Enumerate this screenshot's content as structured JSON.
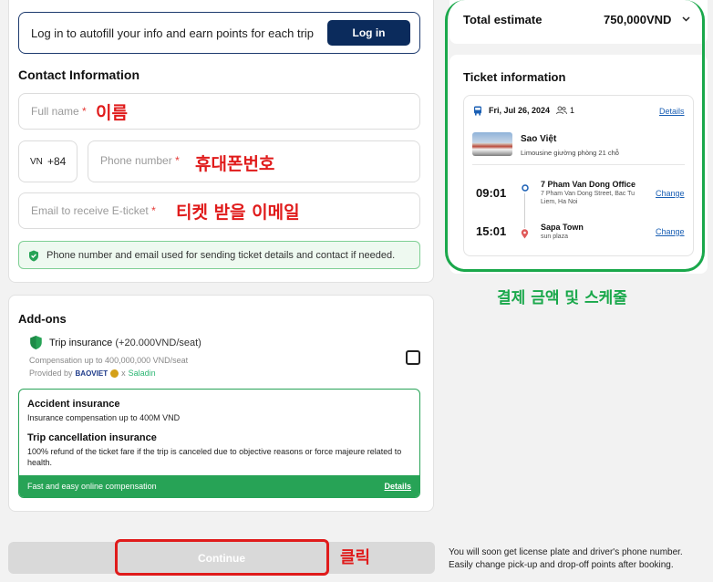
{
  "login": {
    "text": "Log in to autofill your info and earn points for each trip",
    "button": "Log in"
  },
  "contact": {
    "title": "Contact Information",
    "full_name_placeholder": "Full name",
    "country_code": "VN",
    "dial_code": "+84",
    "phone_placeholder": "Phone number",
    "email_placeholder": "Email to receive E-ticket",
    "required_mark": "*",
    "notice": "Phone number and email used for sending ticket details and contact if needed."
  },
  "annotations": {
    "name": "이름",
    "phone": "휴대폰번호",
    "email": "티켓 받을 이메일",
    "summary": "결제 금액 및 스케줄",
    "click": "클릭"
  },
  "addons": {
    "title": "Add-ons",
    "trip_insurance_label": "Trip insurance",
    "trip_insurance_price": "(+20.000VND/seat)",
    "compensation": "Compensation up to 400,000,000 VND/seat",
    "provided_by": "Provided by",
    "provider_1": "BAOVIET",
    "provider_x": "x",
    "provider_2": "Saladin",
    "accident_title": "Accident insurance",
    "accident_desc": "Insurance compensation up to 400M VND",
    "cancel_title": "Trip cancellation insurance",
    "cancel_desc": "100% refund of the ticket fare if the trip is canceled due to objective reasons or force majeure related to health.",
    "footer_text": "Fast and easy online compensation",
    "footer_link": "Details"
  },
  "summary": {
    "total_label": "Total estimate",
    "total_value": "750,000VND",
    "ticket_title": "Ticket information",
    "date": "Fri, Jul 26, 2024",
    "passengers": "1",
    "details_link": "Details",
    "operator": "Sao Việt",
    "vehicle": "Limousine giường phòng 21 chỗ",
    "departure_time": "09:01",
    "departure_place": "7 Pham Van Dong Office",
    "departure_address": "7 Pham Van Dong Street, Bac Tu Liem, Ha Noi",
    "arrival_time": "15:01",
    "arrival_place": "Sapa Town",
    "arrival_address": "sun plaza",
    "change_link": "Change"
  },
  "bottom": {
    "continue": "Continue",
    "note_line1": "You will soon get license plate and driver's phone number.",
    "note_line2": "Easily change pick-up and drop-off points after booking."
  },
  "colors": {
    "brand_navy": "#0b2b5c",
    "accent_green": "#27a356",
    "annotation_red": "#e01b1b",
    "annotation_green": "#1aa84b"
  }
}
